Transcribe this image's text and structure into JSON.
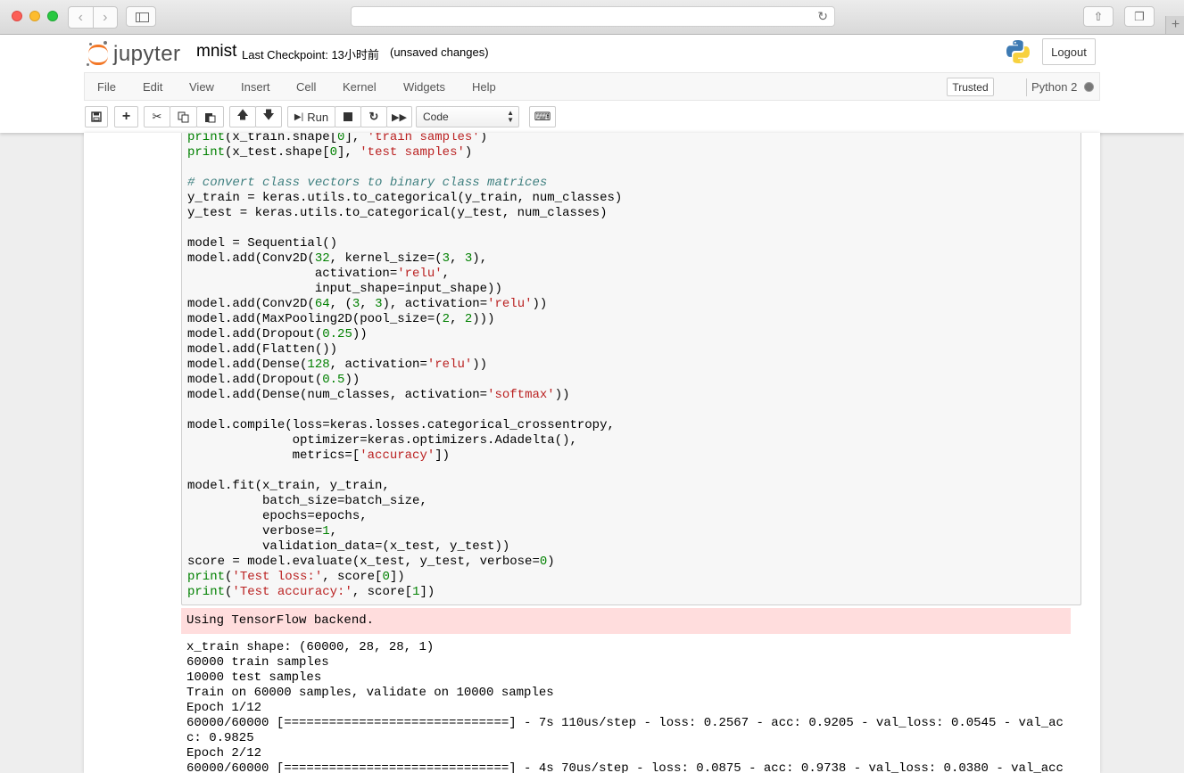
{
  "browser": {
    "back_icon": "chevron-left-icon",
    "forward_icon": "chevron-right-icon"
  },
  "header": {
    "logo_text": "jupyter",
    "notebook_name": "mnist",
    "checkpoint": "Last Checkpoint: 13小时前",
    "unsaved": "(unsaved changes)",
    "logout_label": "Logout"
  },
  "menubar": {
    "items": [
      "File",
      "Edit",
      "View",
      "Insert",
      "Cell",
      "Kernel",
      "Widgets",
      "Help"
    ],
    "trusted_label": "Trusted",
    "kernel_name": "Python 2"
  },
  "toolbar": {
    "run_label": "Run",
    "cell_type": "Code"
  },
  "cell": {
    "code_lines": [
      "print(x_train.shape[0], 'train samples')",
      "print(x_test.shape[0], 'test samples')",
      "",
      "# convert class vectors to binary class matrices",
      "y_train = keras.utils.to_categorical(y_train, num_classes)",
      "y_test = keras.utils.to_categorical(y_test, num_classes)",
      "",
      "model = Sequential()",
      "model.add(Conv2D(32, kernel_size=(3, 3),",
      "                 activation='relu',",
      "                 input_shape=input_shape))",
      "model.add(Conv2D(64, (3, 3), activation='relu'))",
      "model.add(MaxPooling2D(pool_size=(2, 2)))",
      "model.add(Dropout(0.25))",
      "model.add(Flatten())",
      "model.add(Dense(128, activation='relu'))",
      "model.add(Dropout(0.5))",
      "model.add(Dense(num_classes, activation='softmax'))",
      "",
      "model.compile(loss=keras.losses.categorical_crossentropy,",
      "              optimizer=keras.optimizers.Adadelta(),",
      "              metrics=['accuracy'])",
      "",
      "model.fit(x_train, y_train,",
      "          batch_size=batch_size,",
      "          epochs=epochs,",
      "          verbose=1,",
      "          validation_data=(x_test, y_test))",
      "score = model.evaluate(x_test, y_test, verbose=0)",
      "print('Test loss:', score[0])",
      "print('Test accuracy:', score[1])"
    ],
    "stderr": "Using TensorFlow backend.",
    "stdout_lines": [
      "x_train shape: (60000, 28, 28, 1)",
      "60000 train samples",
      "10000 test samples",
      "Train on 60000 samples, validate on 10000 samples",
      "Epoch 1/12",
      "60000/60000 [==============================] - 7s 110us/step - loss: 0.2567 - acc: 0.9205 - val_loss: 0.0545 - val_ac",
      "c: 0.9825",
      "Epoch 2/12",
      "60000/60000 [==============================] - 4s 70us/step - loss: 0.0875 - acc: 0.9738 - val_loss: 0.0380 - val_acc"
    ]
  }
}
